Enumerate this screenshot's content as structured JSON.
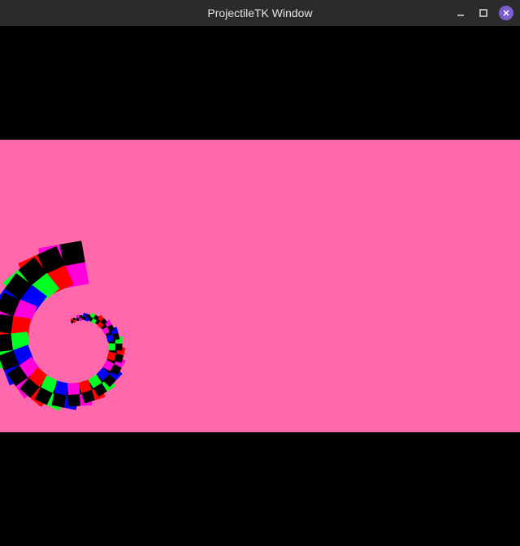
{
  "window": {
    "title": "ProjectileTK Window",
    "controls": [
      {
        "name": "minimize-button",
        "icon": "minimize-icon"
      },
      {
        "name": "maximize-button",
        "icon": "maximize-icon"
      },
      {
        "name": "close-button",
        "icon": "close-icon"
      }
    ]
  },
  "scene": {
    "background_color": "#000000",
    "playfield_color": "#ff69ac",
    "tile_colors": {
      "magenta": "#ff00dc",
      "red": "#ff0000",
      "green": "#00ff22",
      "blue": "#0000ff",
      "black": "#000000"
    },
    "spiral_sequence": [
      "magenta",
      "red",
      "green",
      "blue"
    ]
  }
}
